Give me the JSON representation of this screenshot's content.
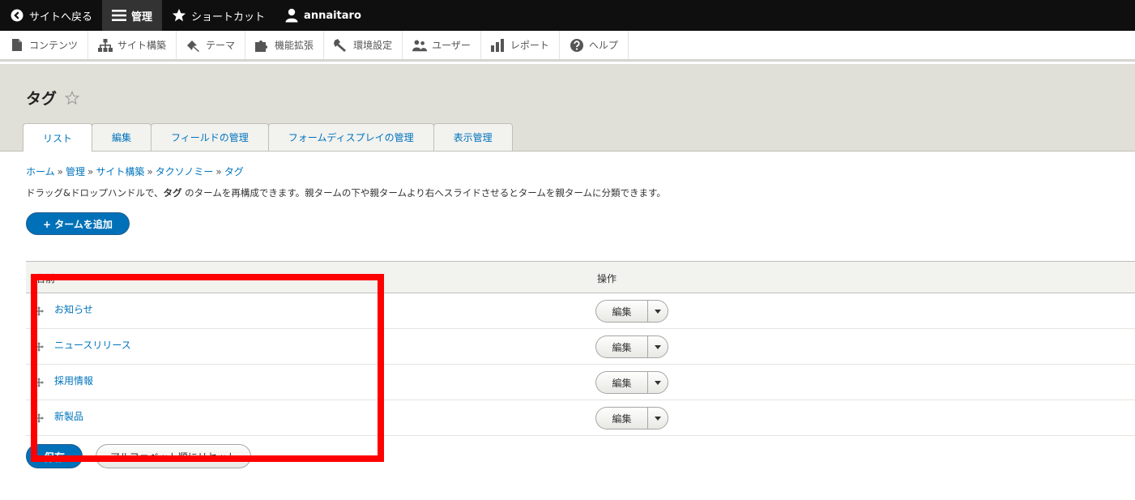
{
  "toolbar_top": {
    "back_label": "サイトへ戻る",
    "manage_label": "管理",
    "shortcuts_label": "ショートカット",
    "user_label": "annaitaro"
  },
  "toolbar_tray": {
    "items": [
      {
        "label": "コンテンツ",
        "icon": "file-icon"
      },
      {
        "label": "サイト構築",
        "icon": "sitemap-icon"
      },
      {
        "label": "テーマ",
        "icon": "paintbrush-icon"
      },
      {
        "label": "機能拡張",
        "icon": "puzzle-icon"
      },
      {
        "label": "環境設定",
        "icon": "wrench-icon"
      },
      {
        "label": "ユーザー",
        "icon": "people-icon"
      },
      {
        "label": "レポート",
        "icon": "bar-chart-icon"
      },
      {
        "label": "ヘルプ",
        "icon": "help-icon"
      }
    ]
  },
  "page": {
    "title": "タグ",
    "tabs": [
      {
        "label": "リスト",
        "active": true
      },
      {
        "label": "編集",
        "active": false
      },
      {
        "label": "フィールドの管理",
        "active": false
      },
      {
        "label": "フォームディスプレイの管理",
        "active": false
      },
      {
        "label": "表示管理",
        "active": false
      }
    ]
  },
  "breadcrumb": {
    "items": [
      "ホーム",
      "管理",
      "サイト構築",
      "タクソノミー",
      "タグ"
    ],
    "separator": "»"
  },
  "help": {
    "prefix": "ドラッグ&ドロップハンドルで、",
    "bold": "タグ",
    "suffix": " のタームを再構成できます。親タームの下や親タームより右へスライドさせるとタームを親タームに分類できます。"
  },
  "add_button_label": "+ タームを追加",
  "table": {
    "col_name": "名前",
    "col_ops": "操作",
    "rows": [
      {
        "name": "お知らせ",
        "edit_label": "編集"
      },
      {
        "name": "ニュースリリース",
        "edit_label": "編集"
      },
      {
        "name": "採用情報",
        "edit_label": "編集"
      },
      {
        "name": "新製品",
        "edit_label": "編集"
      }
    ]
  },
  "save_label": "保存",
  "reset_label": "アルファベット順にリセット",
  "colors": {
    "accent": "#0074bd",
    "primary_button": "#0071b8",
    "highlight": "#ff0000"
  }
}
